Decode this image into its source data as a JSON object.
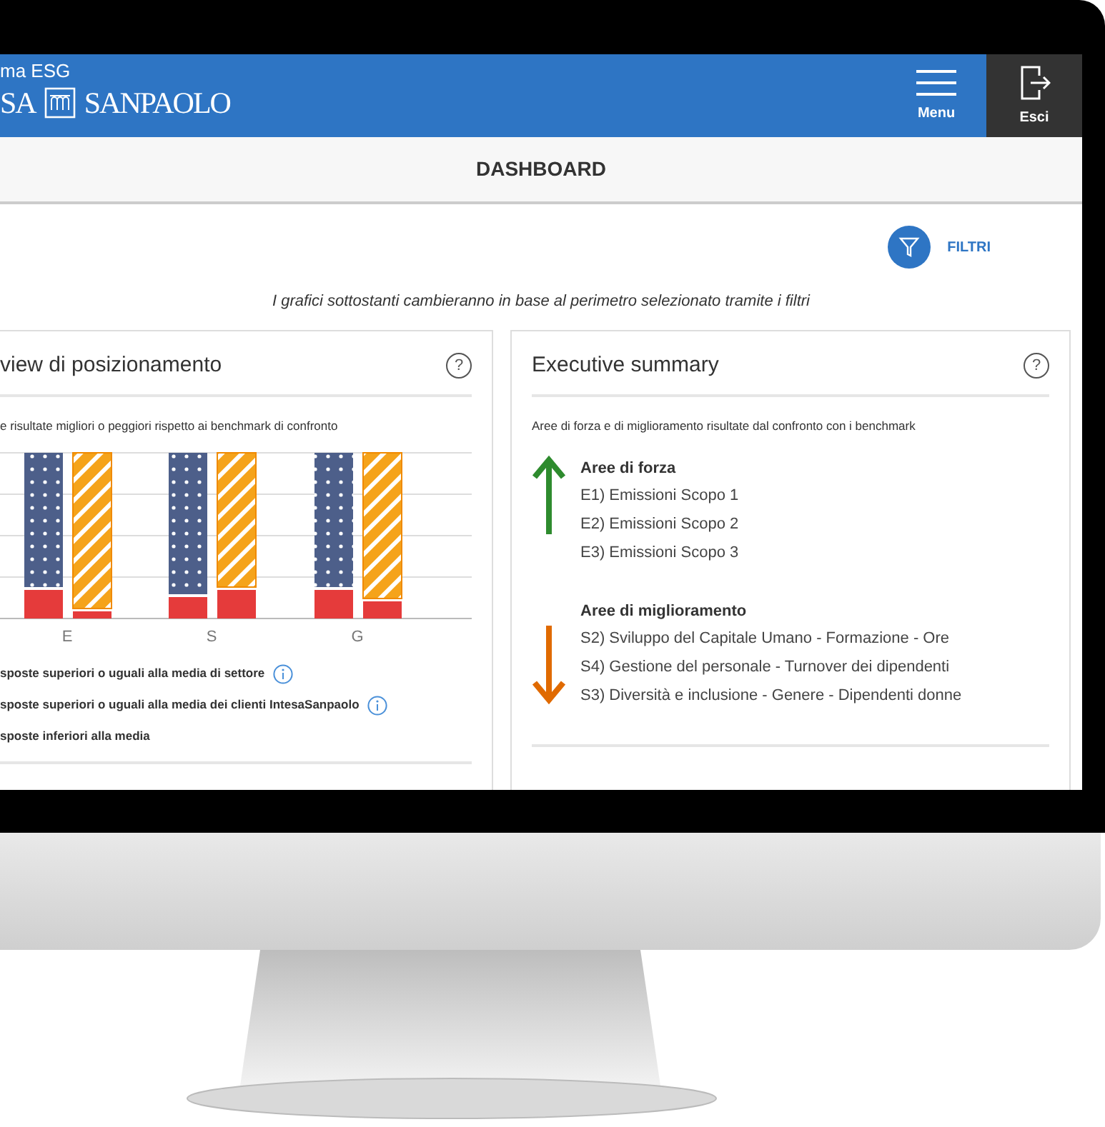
{
  "header": {
    "title": "ma ESG",
    "brand_left": "SA",
    "brand_right": "SANPAOLO",
    "menu_label": "Menu",
    "exit_label": "Esci"
  },
  "page_title": "DASHBOARD",
  "filter_button": "FILTRI",
  "notice": "I grafici sottostanti cambieranno in base al perimetro selezionato tramite i filtri",
  "positioning_card": {
    "title": "view di posizionamento",
    "help": "?",
    "subtitle": "e risultate migliori o peggiori rispetto ai benchmark di confronto",
    "categories": [
      "E",
      "S",
      "G"
    ],
    "legend": [
      {
        "text": "sposte superiori o uguali alla media di settore",
        "info": true
      },
      {
        "text": "sposte superiori o uguali alla media dei clienti IntesaSanpaolo",
        "info": true
      },
      {
        "text": "sposte inferiori alla media",
        "info": false
      }
    ]
  },
  "summary_card": {
    "title": "Executive summary",
    "help": "?",
    "subtitle": "Aree di forza e di miglioramento risultate dal confronto con i benchmark",
    "groups": [
      {
        "kind": "strength",
        "heading": "Aree di forza",
        "items": [
          "E1) Emissioni Scopo 1",
          "E2) Emissioni Scopo 2",
          "E3) Emissioni Scopo 3"
        ]
      },
      {
        "kind": "improvement",
        "heading": "Aree di miglioramento",
        "items": [
          "S2) Sviluppo del Capitale Umano -  Formazione - Ore",
          "S4) Gestione del personale - Turnover dei dipendenti",
          "S3) Diversità e inclusione - Genere - Dipendenti donne"
        ]
      }
    ]
  }
}
